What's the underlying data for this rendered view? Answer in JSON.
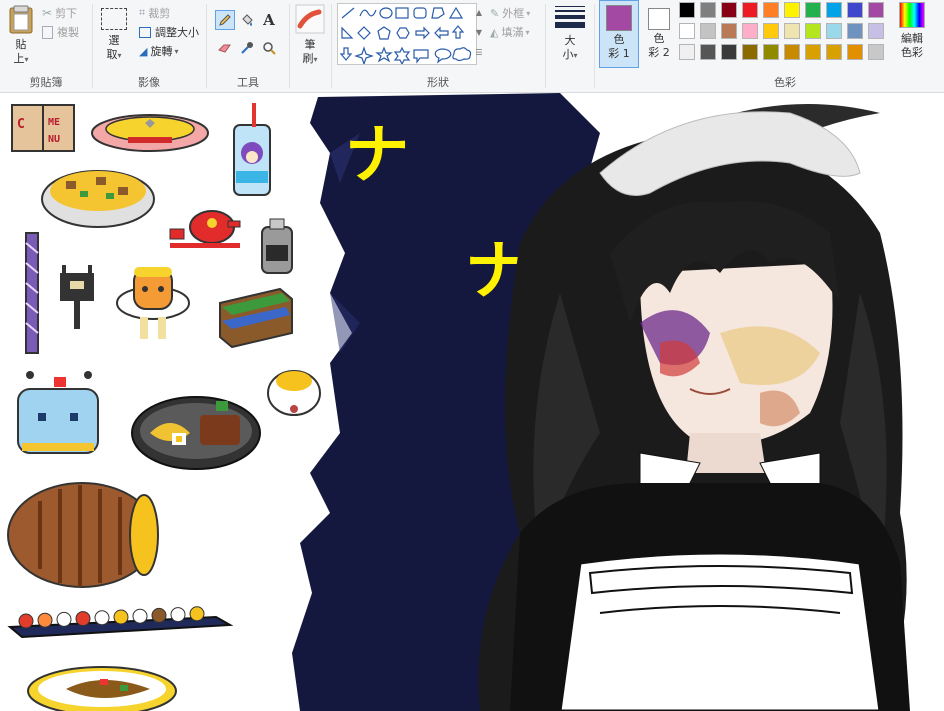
{
  "ribbon": {
    "clipboard": {
      "group_label": "剪貼簿",
      "paste_label": "貼",
      "paste_sub": "上",
      "cut_label": "剪下",
      "copy_label": "複製"
    },
    "image": {
      "group_label": "影像",
      "select_label": "選",
      "select_sub": "取",
      "crop_label": "裁剪",
      "resize_label": "調整大小",
      "rotate_label": "旋轉"
    },
    "tools": {
      "group_label": "工具",
      "tool_icons": [
        "pencil-icon",
        "fill-icon",
        "text-icon",
        "eraser-icon",
        "color-picker-icon",
        "magnifier-icon"
      ]
    },
    "brushes": {
      "label": "筆",
      "sub": "刷"
    },
    "shapes": {
      "group_label": "形狀",
      "outline_label": "外框",
      "fill_label": "填滿",
      "shape_icons": [
        "line-icon",
        "curve-icon",
        "oval-icon",
        "rectangle-icon",
        "rounded-rectangle-icon",
        "polygon-icon",
        "triangle-icon",
        "right-triangle-icon",
        "diamond-icon",
        "pentagon-icon",
        "hexagon-icon",
        "right-arrow-icon",
        "left-arrow-icon",
        "up-arrow-icon",
        "down-arrow-icon",
        "four-point-star-icon",
        "five-point-star-icon",
        "six-point-star-icon",
        "rect-callout-icon",
        "oval-callout-icon",
        "cloud-callout-icon"
      ]
    },
    "size": {
      "label": "大",
      "sub": "小"
    },
    "colors": {
      "group_label": "色彩",
      "color1_label": "色",
      "color1_sub": "彩 1",
      "color2_label": "色",
      "color2_sub": "彩 2",
      "color1_value": "#a349a4",
      "color2_value": "#ffffff",
      "edit_label": "編輯",
      "edit_sub": "色彩",
      "palette_row1": [
        "#000000",
        "#7f7f7f",
        "#880015",
        "#ed1c24",
        "#ff7f27",
        "#fff200",
        "#22b14c",
        "#00a2e8",
        "#3f48cc",
        "#a349a4"
      ],
      "palette_row2": [
        "#ffffff",
        "#c3c3c3",
        "#b97a57",
        "#ffaec9",
        "#ffc90e",
        "#efe4b0",
        "#b5e61d",
        "#99d9ea",
        "#7092be",
        "#c8bfe7"
      ],
      "palette_row3": [
        "#f0f0f0",
        "#555555",
        "#3a3a3a",
        "#8b6a00",
        "#8f8a00",
        "#c88a00",
        "#d8a000",
        "#d8a000",
        "#e09000",
        "#c8c8c8"
      ]
    }
  },
  "canvas": {
    "annotations": [
      "ナ",
      "ナ"
    ],
    "stroke_color": "#fff200",
    "background_fill": "#14183f"
  }
}
